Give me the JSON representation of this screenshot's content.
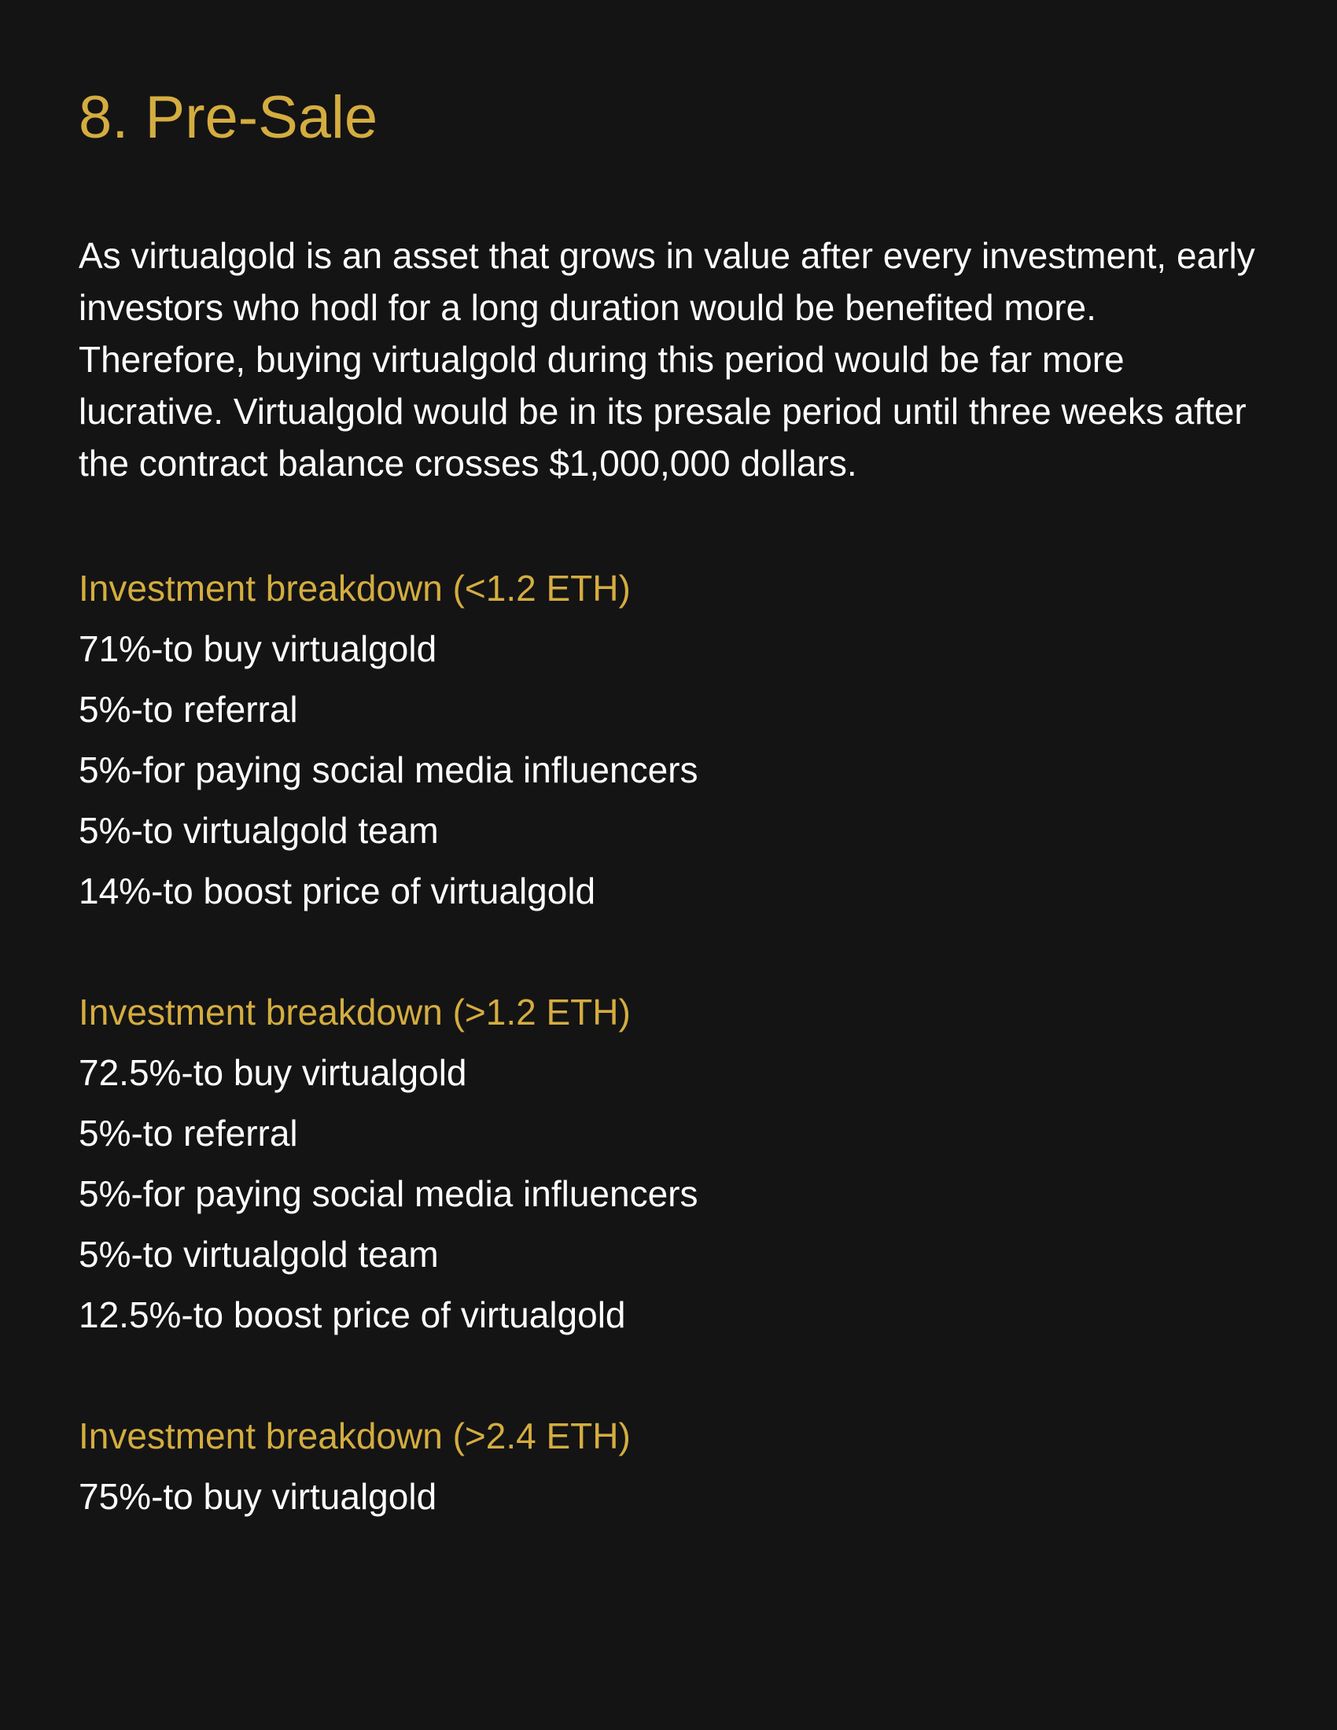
{
  "page": {
    "title": "8. Pre-Sale",
    "intro": "As virtualgold is an asset that grows in value after every investment, early investors who hodl for a long duration would be benefited more. Therefore, buying virtualgold during this period would be far more lucrative. Virtualgold would be in its presale period until three weeks after the contract balance crosses $1,000,000 dollars."
  },
  "sections": [
    {
      "heading": "Investment breakdown (<1.2 ETH)",
      "items": [
        "71%-to buy virtualgold",
        "5%-to referral",
        "5%-for paying social media influencers",
        "5%-to virtualgold team",
        "14%-to boost price of virtualgold"
      ]
    },
    {
      "heading": "Investment breakdown (>1.2 ETH)",
      "items": [
        "72.5%-to buy virtualgold",
        "5%-to referral",
        "5%-for paying social media influencers",
        "5%-to virtualgold team",
        "12.5%-to boost price of virtualgold"
      ]
    },
    {
      "heading": "Investment breakdown (>2.4 ETH)",
      "items": [
        "75%-to buy virtualgold"
      ]
    }
  ],
  "colors": {
    "background": "#141414",
    "heading": "#d4ad40",
    "text": "#ffffff"
  }
}
